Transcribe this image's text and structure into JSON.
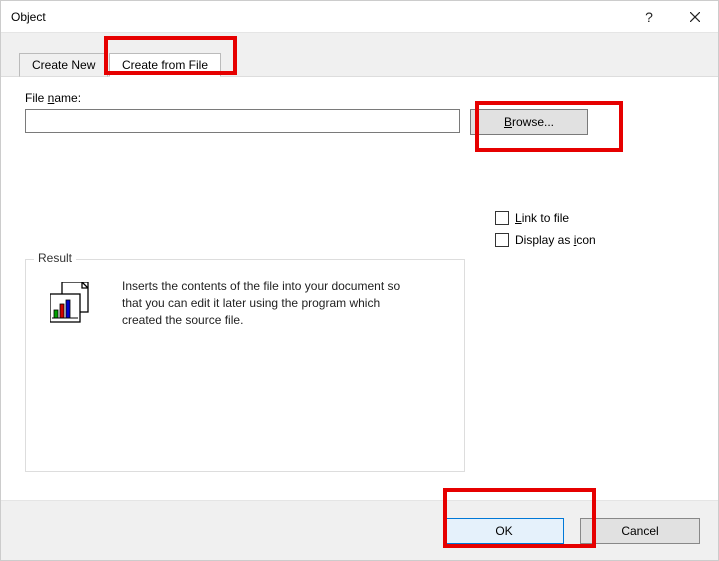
{
  "titlebar": {
    "title": "Object"
  },
  "tabs": {
    "create_new": "Create New",
    "create_from_file": "Create from File"
  },
  "filename": {
    "label_pre": "File ",
    "label_underline": "n",
    "label_post": "ame:",
    "value": "",
    "browse_underline": "B",
    "browse_post": "rowse..."
  },
  "options": {
    "link_underline": "L",
    "link_post": "ink to file",
    "icon_pre": "Display as ",
    "icon_underline": "i",
    "icon_post": "con"
  },
  "result": {
    "title": "Result",
    "text": "Inserts the contents of the file into your document so that you can edit it later using the program which created the source file."
  },
  "footer": {
    "ok": "OK",
    "cancel": "Cancel"
  }
}
